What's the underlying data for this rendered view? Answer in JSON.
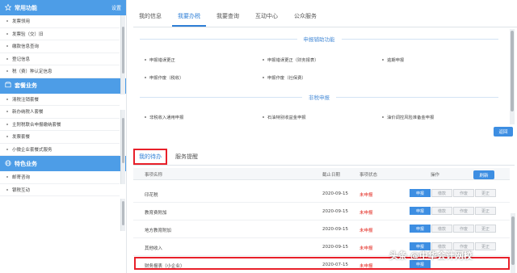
{
  "sidebar": {
    "section1": {
      "title": "常用功能",
      "settings": "设置"
    },
    "items1": [
      "发票领用",
      "发票验（交）旧",
      "缴款信息查询",
      "登记信息",
      "税（费）种认定信息"
    ],
    "section2": {
      "title": "套餐业务"
    },
    "items2": [
      "清税注销套餐",
      "新办纳税人套餐",
      "主附税联合申报缴纳套餐",
      "发票套餐",
      "小微企业套餐式服务"
    ],
    "section3": {
      "title": "特色业务"
    },
    "items3": [
      "邮寄咨询",
      "银税互动"
    ]
  },
  "top_tabs": [
    "我的信息",
    "我要办税",
    "我要查询",
    "互动中心",
    "公众服务"
  ],
  "top_active": "我要办税",
  "filing": {
    "assist_title": "申报辅助功能",
    "assist_items": [
      "申报错误更正",
      "申报错误更正（财务报表）",
      "逾期申报",
      "申报作废（税收）",
      "申报作废（社保费）"
    ],
    "nontax_title": "非税申报",
    "nontax_items": [
      "非税收入通用申报",
      "石油特别收益金申报",
      "油价调控风险准备金申报"
    ],
    "back_label": "返回"
  },
  "todo": {
    "tabs": [
      "我的待办",
      "服务提醒"
    ],
    "active_tab": "我的待办",
    "headers": {
      "name": "事项名称",
      "date": "截止日期",
      "status": "事项状态",
      "ops": "操作"
    },
    "refresh_label": "刷新",
    "op_labels": [
      "申报",
      "缴款",
      "作废",
      "更正"
    ],
    "rows": [
      {
        "name": "印花税",
        "date": "2020-09-15",
        "status": "未申报"
      },
      {
        "name": "教育费附加",
        "date": "2020-09-15",
        "status": "未申报"
      },
      {
        "name": "地方教育附加",
        "date": "2020-09-15",
        "status": "未申报"
      },
      {
        "name": "其他收入",
        "date": "2020-09-15",
        "status": "未申报"
      },
      {
        "name": "财务报表（小企业）",
        "date": "2020-07-15",
        "status": "未申报"
      }
    ]
  },
  "watermark": "头条 @中华会计网校",
  "colors": {
    "accent": "#4d9de7",
    "button": "#3d8ee2",
    "highlight": "#e8202a",
    "status": "#e2231a"
  }
}
